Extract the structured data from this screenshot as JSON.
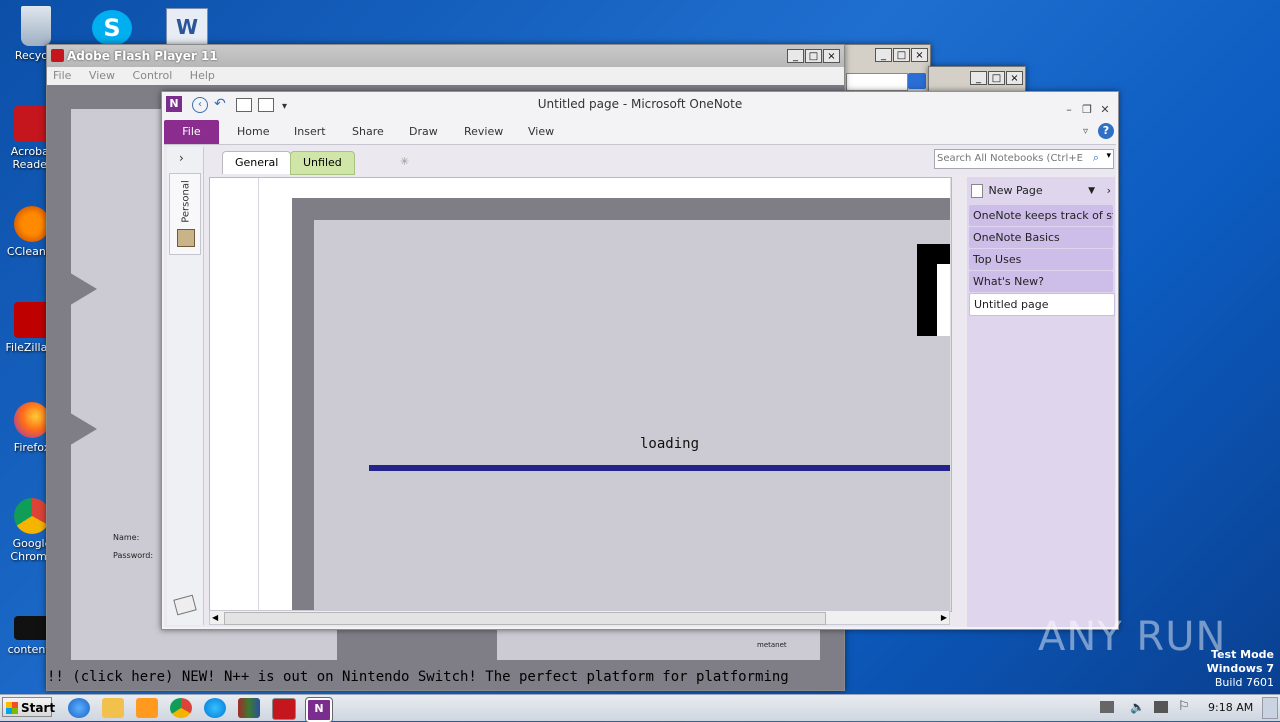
{
  "desktop": {
    "icons": [
      {
        "label": "Recycle",
        "icon": "recycle-bin-icon"
      },
      {
        "label": "Acrobat Reader",
        "icon": "acrobat-icon"
      },
      {
        "label": "CCleaner",
        "icon": "ccleaner-icon"
      },
      {
        "label": "FileZilla C",
        "icon": "filezilla-icon"
      },
      {
        "label": "Firefox",
        "icon": "firefox-icon"
      },
      {
        "label": "Google Chrome",
        "icon": "chrome-icon"
      },
      {
        "label": "contenta",
        "icon": "file-icon"
      }
    ],
    "watermark": "ANY RUN",
    "os_info": {
      "line1": "Test Mode",
      "line2": "Windows 7",
      "line3": "Build 7601"
    }
  },
  "flash_window": {
    "title": "Adobe Flash Player 11",
    "menu": [
      "File",
      "View",
      "Control",
      "Help"
    ],
    "name_label": "Name:",
    "password_label": "Password:",
    "metanet_label": "metanet",
    "marquee": "!! (click here)     NEW! N++ is out on Nintendo Switch! The perfect platform for platforming"
  },
  "onenote_window": {
    "title": "Untitled page - Microsoft OneNote",
    "ribbon_tabs": [
      "File",
      "Home",
      "Insert",
      "Share",
      "Draw",
      "Review",
      "View"
    ],
    "notebook_label": "Personal",
    "section_tabs": [
      "General",
      "Unfiled Notes"
    ],
    "search_placeholder": "Search All Notebooks (Ctrl+E)",
    "new_page_label": "New Page",
    "pages": [
      "OneNote keeps track of st",
      "OneNote Basics",
      "Top Uses",
      "What's New?",
      "Untitled page"
    ],
    "loading_text": "loading",
    "colors": {
      "accent": "#8a2d8e",
      "loading_bar": "#23238c"
    }
  },
  "taskbar": {
    "start_label": "Start",
    "time": "9:18 AM"
  }
}
